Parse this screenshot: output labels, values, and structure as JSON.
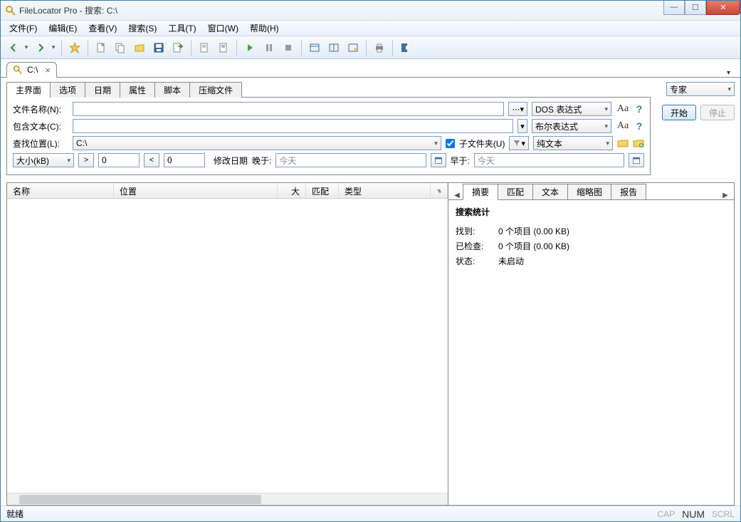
{
  "window": {
    "title": "FileLocator Pro - 搜索: C:\\"
  },
  "menu": {
    "file": "文件(F)",
    "edit": "编辑(E)",
    "view": "查看(V)",
    "search": "搜索(S)",
    "tools": "工具(T)",
    "window": "窗口(W)",
    "help": "帮助(H)"
  },
  "doc_tab": {
    "label": "C:\\"
  },
  "param_tabs": {
    "main": "主界面",
    "options": "选项",
    "date": "日期",
    "attrs": "属性",
    "script": "脚本",
    "archive": "压缩文件"
  },
  "mode": {
    "expert": "专家"
  },
  "buttons": {
    "start": "开始",
    "stop": "停止"
  },
  "labels": {
    "filename": "文件名称(N):",
    "contains": "包含文本(C):",
    "lookin": "查找位置(L):",
    "size": "大小(kB)",
    "moddate": "修改日期",
    "after": "晚于:",
    "before": "早于:",
    "subfolders": "子文件夹(U)"
  },
  "inputs": {
    "filename": "",
    "contains": "",
    "lookin": "C:\\",
    "size_min": "0",
    "size_max": "0",
    "after": "今天",
    "before": "今天"
  },
  "expr": {
    "dos": "DOS 表达式",
    "bool": "布尔表达式",
    "plaintext": "纯文本"
  },
  "columns": {
    "name": "名称",
    "location": "位置",
    "size": "大小",
    "match": "匹配",
    "type": "类型"
  },
  "right_tabs": {
    "summary": "摘要",
    "match": "匹配",
    "text": "文本",
    "thumb": "缩略图",
    "report": "报告"
  },
  "summary": {
    "title": "搜索统计",
    "found_k": "找到:",
    "found_v": "0 个项目 (0.00 KB)",
    "checked_k": "已检查:",
    "checked_v": "0 个项目 (0.00 KB)",
    "status_k": "状态:",
    "status_v": "未启动"
  },
  "status": {
    "ready": "就绪",
    "cap": "CAP",
    "num": "NUM",
    "scrl": "SCRL"
  }
}
